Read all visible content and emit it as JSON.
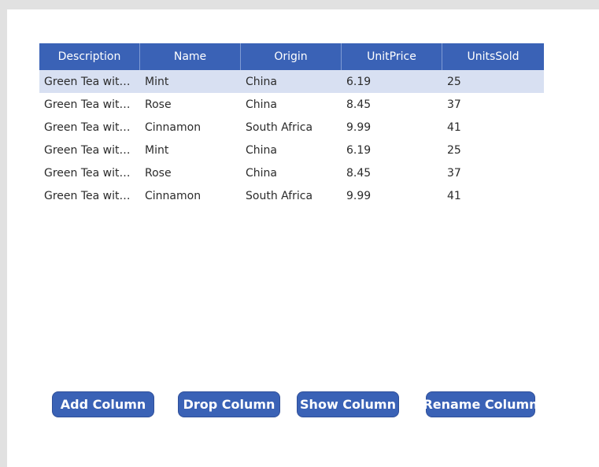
{
  "table": {
    "columns": [
      "Description",
      "Name",
      "Origin",
      "UnitPrice",
      "UnitsSold"
    ],
    "rows": [
      [
        "Green Tea with ...",
        "Mint",
        "China",
        "6.19",
        "25"
      ],
      [
        "Green Tea with ...",
        "Rose",
        "China",
        "8.45",
        "37"
      ],
      [
        "Green Tea with ...",
        "Cinnamon",
        "South Africa",
        "9.99",
        "41"
      ],
      [
        "Green Tea with ...",
        "Mint",
        "China",
        "6.19",
        "25"
      ],
      [
        "Green Tea with ...",
        "Rose",
        "China",
        "8.45",
        "37"
      ],
      [
        "Green Tea with ...",
        "Cinnamon",
        "South Africa",
        "9.99",
        "41"
      ]
    ],
    "selected_row": 0
  },
  "buttons": {
    "add_column": "Add Column",
    "drop_column": "Drop Column",
    "show_column": "Show Column",
    "rename_column": "Rename Column"
  },
  "colors": {
    "header_bg": "#3a62b6",
    "selected_row_bg": "#d8e0f2",
    "button_bg": "#3a62b6",
    "frame_bg": "#e1e1e1"
  }
}
